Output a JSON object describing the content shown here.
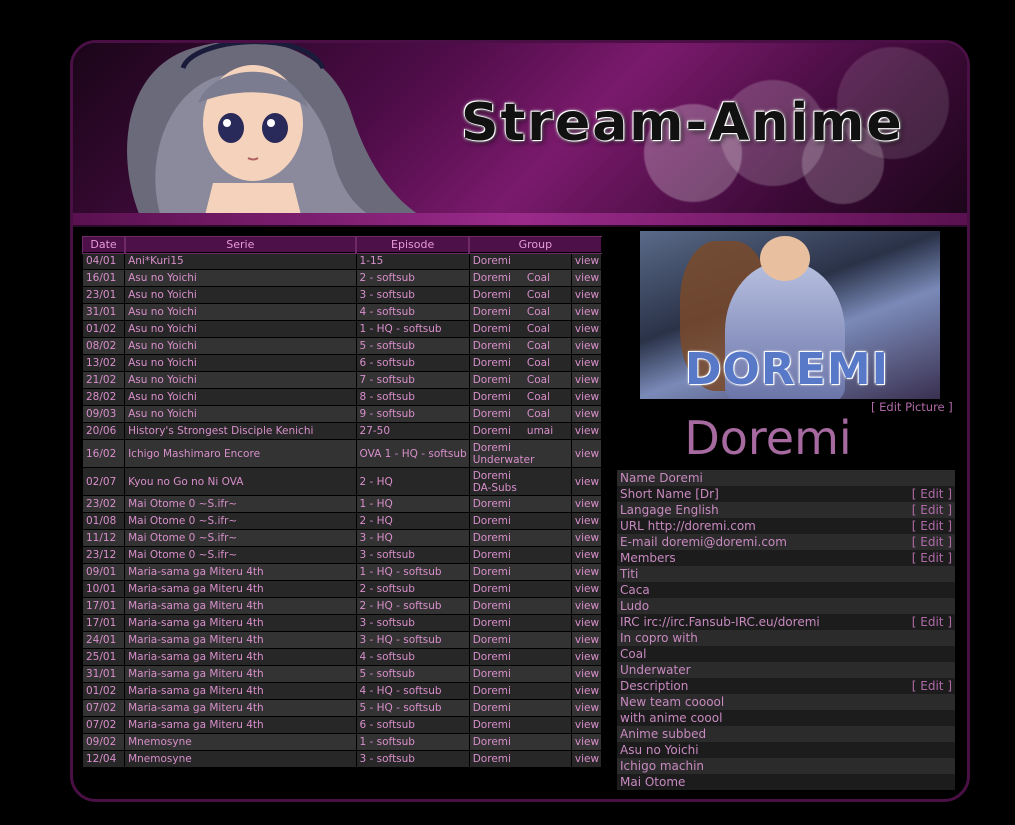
{
  "banner": {
    "logo_text": "Stream-Anime"
  },
  "table": {
    "headers": [
      "Date",
      "Serie",
      "Episode",
      "Group"
    ],
    "view_label": "view",
    "rows": [
      {
        "date": "04/01",
        "serie": "Ani*Kuri15",
        "episode": "1-15",
        "group": "Doremi",
        "group2": ""
      },
      {
        "date": "16/01",
        "serie": "Asu no Yoichi",
        "episode": "2 - softsub",
        "group": "Doremi",
        "group2": "Coal"
      },
      {
        "date": "23/01",
        "serie": "Asu no Yoichi",
        "episode": "3 - softsub",
        "group": "Doremi",
        "group2": "Coal"
      },
      {
        "date": "31/01",
        "serie": "Asu no Yoichi",
        "episode": "4 - softsub",
        "group": "Doremi",
        "group2": "Coal"
      },
      {
        "date": "01/02",
        "serie": "Asu no Yoichi",
        "episode": "1 - HQ - softsub",
        "group": "Doremi",
        "group2": "Coal"
      },
      {
        "date": "08/02",
        "serie": "Asu no Yoichi",
        "episode": "5 - softsub",
        "group": "Doremi",
        "group2": "Coal"
      },
      {
        "date": "13/02",
        "serie": "Asu no Yoichi",
        "episode": "6 - softsub",
        "group": "Doremi",
        "group2": "Coal"
      },
      {
        "date": "21/02",
        "serie": "Asu no Yoichi",
        "episode": "7 - softsub",
        "group": "Doremi",
        "group2": "Coal"
      },
      {
        "date": "28/02",
        "serie": "Asu no Yoichi",
        "episode": "8 - softsub",
        "group": "Doremi",
        "group2": "Coal"
      },
      {
        "date": "09/03",
        "serie": "Asu no Yoichi",
        "episode": "9 - softsub",
        "group": "Doremi",
        "group2": "Coal"
      },
      {
        "date": "20/06",
        "serie": "History's Strongest Disciple Kenichi",
        "episode": "27-50",
        "group": "Doremi",
        "group2": "umai"
      },
      {
        "date": "16/02",
        "serie": "Ichigo Mashimaro Encore",
        "episode": "OVA 1 - HQ - softsub",
        "group": "Doremi",
        "group2": "Underwater",
        "stack": true
      },
      {
        "date": "02/07",
        "serie": "Kyou no Go no Ni OVA",
        "episode": "2 - HQ",
        "group": "Doremi",
        "group2": "DA-Subs",
        "stack": true
      },
      {
        "date": "23/02",
        "serie": "Mai Otome 0 ~S.ifr~",
        "episode": "1 - HQ",
        "group": "Doremi",
        "group2": ""
      },
      {
        "date": "01/08",
        "serie": "Mai Otome 0 ~S.ifr~",
        "episode": "2 - HQ",
        "group": "Doremi",
        "group2": ""
      },
      {
        "date": "11/12",
        "serie": "Mai Otome 0 ~S.ifr~",
        "episode": "3 - HQ",
        "group": "Doremi",
        "group2": ""
      },
      {
        "date": "23/12",
        "serie": "Mai Otome 0 ~S.ifr~",
        "episode": "3 - softsub",
        "group": "Doremi",
        "group2": ""
      },
      {
        "date": "09/01",
        "serie": "Maria-sama ga Miteru 4th",
        "episode": "1 - HQ - softsub",
        "group": "Doremi",
        "group2": ""
      },
      {
        "date": "10/01",
        "serie": "Maria-sama ga Miteru 4th",
        "episode": "2 - softsub",
        "group": "Doremi",
        "group2": ""
      },
      {
        "date": "17/01",
        "serie": "Maria-sama ga Miteru 4th",
        "episode": "2 - HQ - softsub",
        "group": "Doremi",
        "group2": ""
      },
      {
        "date": "17/01",
        "serie": "Maria-sama ga Miteru 4th",
        "episode": "3 - softsub",
        "group": "Doremi",
        "group2": ""
      },
      {
        "date": "24/01",
        "serie": "Maria-sama ga Miteru 4th",
        "episode": "3 - HQ - softsub",
        "group": "Doremi",
        "group2": ""
      },
      {
        "date": "25/01",
        "serie": "Maria-sama ga Miteru 4th",
        "episode": "4 - softsub",
        "group": "Doremi",
        "group2": ""
      },
      {
        "date": "31/01",
        "serie": "Maria-sama ga Miteru 4th",
        "episode": "5 - softsub",
        "group": "Doremi",
        "group2": ""
      },
      {
        "date": "01/02",
        "serie": "Maria-sama ga Miteru 4th",
        "episode": "4 - HQ - softsub",
        "group": "Doremi",
        "group2": ""
      },
      {
        "date": "07/02",
        "serie": "Maria-sama ga Miteru 4th",
        "episode": "5 - HQ - softsub",
        "group": "Doremi",
        "group2": ""
      },
      {
        "date": "07/02",
        "serie": "Maria-sama ga Miteru 4th",
        "episode": "6 - softsub",
        "group": "Doremi",
        "group2": ""
      },
      {
        "date": "09/02",
        "serie": "Mnemosyne",
        "episode": "1 - softsub",
        "group": "Doremi",
        "group2": ""
      },
      {
        "date": "12/04",
        "serie": "Mnemosyne",
        "episode": "3 - softsub",
        "group": "Doremi",
        "group2": ""
      }
    ]
  },
  "team": {
    "picture_wordmark": "DOREMI",
    "edit_picture_label": "[ Edit Picture ]",
    "title": "Doremi",
    "edit_label": "[ Edit ]",
    "info": [
      {
        "text": "Name Doremi",
        "edit": false
      },
      {
        "text": "Short Name [Dr]",
        "edit": true
      },
      {
        "text": "Langage English",
        "edit": true
      },
      {
        "text": "URL http://doremi.com",
        "edit": true
      },
      {
        "text": "E-mail doremi@doremi.com",
        "edit": true
      },
      {
        "text": "Members",
        "edit": true
      },
      {
        "text": "Titi",
        "edit": false
      },
      {
        "text": "Caca",
        "edit": false
      },
      {
        "text": "Ludo",
        "edit": false
      },
      {
        "text": "IRC irc://irc.Fansub-IRC.eu/doremi",
        "edit": true
      },
      {
        "text": "In copro with",
        "edit": false
      },
      {
        "text": "Coal",
        "edit": false
      },
      {
        "text": "Underwater",
        "edit": false
      },
      {
        "text": "Description",
        "edit": true
      },
      {
        "text": "New team cooool",
        "edit": false
      },
      {
        "text": "with anime coool",
        "edit": false
      },
      {
        "text": "Anime subbed",
        "edit": false
      },
      {
        "text": "Asu no Yoichi",
        "edit": false
      },
      {
        "text": "Ichigo machin",
        "edit": false
      },
      {
        "text": "Mai Otome",
        "edit": false
      }
    ]
  },
  "colors": {
    "accent": "#d88fcb",
    "header": "#4e1048",
    "frame": "#4a0f45"
  }
}
